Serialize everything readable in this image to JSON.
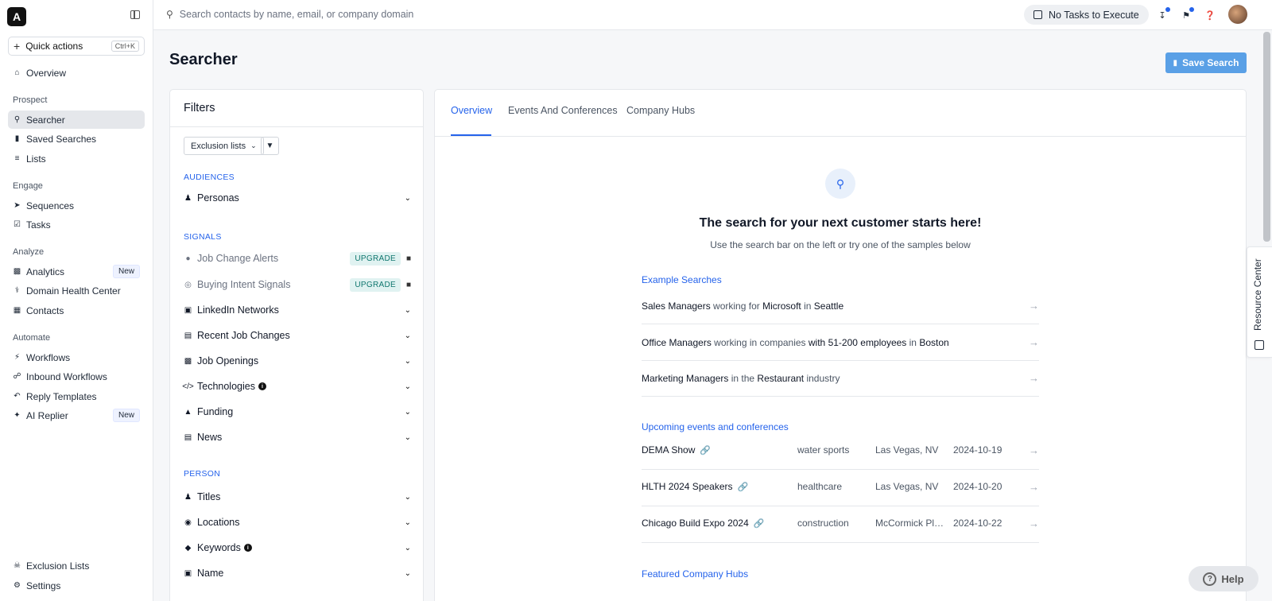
{
  "sidebar": {
    "logo": "A",
    "quick_actions": {
      "label": "Quick actions",
      "shortcut": "Ctrl+K"
    },
    "overview": "Overview",
    "sections": {
      "prospect": "Prospect",
      "engage": "Engage",
      "analyze": "Analyze",
      "automate": "Automate"
    },
    "items": {
      "searcher": "Searcher",
      "saved_searches": "Saved Searches",
      "lists": "Lists",
      "sequences": "Sequences",
      "tasks": "Tasks",
      "analytics": "Analytics",
      "analytics_badge": "New",
      "domain_health": "Domain Health Center",
      "contacts": "Contacts",
      "workflows": "Workflows",
      "inbound_workflows": "Inbound Workflows",
      "reply_templates": "Reply Templates",
      "ai_replier": "AI Replier",
      "ai_replier_badge": "New",
      "exclusion_lists": "Exclusion Lists",
      "settings": "Settings"
    }
  },
  "topbar": {
    "search_placeholder": "Search contacts by name, email, or company domain",
    "tasks_label": "No Tasks to Execute"
  },
  "page": {
    "title": "Searcher",
    "save_button": "Save Search"
  },
  "filters": {
    "title": "Filters",
    "exclusion_button": "Exclusion lists",
    "sections": {
      "audiences": "AUDIENCES",
      "signals": "SIGNALS",
      "person": "PERSON"
    },
    "rows": {
      "personas": "Personas",
      "job_change_alerts": "Job Change Alerts",
      "buying_intent": "Buying Intent Signals",
      "upgrade": "UPGRADE",
      "linkedin_networks": "LinkedIn Networks",
      "recent_job_changes": "Recent Job Changes",
      "job_openings": "Job Openings",
      "technologies": "Technologies",
      "funding": "Funding",
      "news": "News",
      "titles": "Titles",
      "locations": "Locations",
      "keywords": "Keywords",
      "name": "Name"
    }
  },
  "overview": {
    "tabs": [
      "Overview",
      "Events And Conferences",
      "Company Hubs"
    ],
    "hero_title": "The search for your next customer starts here!",
    "hero_sub": "Use the search bar on the left or try one of the samples below",
    "example_title": "Example Searches",
    "examples": [
      {
        "a": "Sales Managers",
        "b": " working for ",
        "c": "Microsoft",
        "d": " in ",
        "e": "Seattle",
        "f": ""
      },
      {
        "a": "Office Managers",
        "b": " working in companies ",
        "c": "with 51-200 employees",
        "d": " in ",
        "e": "Boston",
        "f": ""
      },
      {
        "a": "Marketing Managers",
        "b": " in the ",
        "c": "Restaurant",
        "d": " industry",
        "e": "",
        "f": ""
      }
    ],
    "events_title": "Upcoming events and conferences",
    "events": [
      {
        "name": "DEMA Show",
        "category": "water sports",
        "location": "Las Vegas, NV",
        "date": "2024-10-19"
      },
      {
        "name": "HLTH 2024 Speakers",
        "category": "healthcare",
        "location": "Las Vegas, NV",
        "date": "2024-10-20"
      },
      {
        "name": "Chicago Build Expo 2024",
        "category": "construction",
        "location": "McCormick Place",
        "date": "2024-10-22"
      }
    ],
    "featured_title": "Featured Company Hubs"
  },
  "resource_center": "Resource Center",
  "help": "Help",
  "colors": {
    "accent": "#2563eb",
    "save_button": "#5aa0e6",
    "upgrade_bg": "#e0f2f1"
  }
}
